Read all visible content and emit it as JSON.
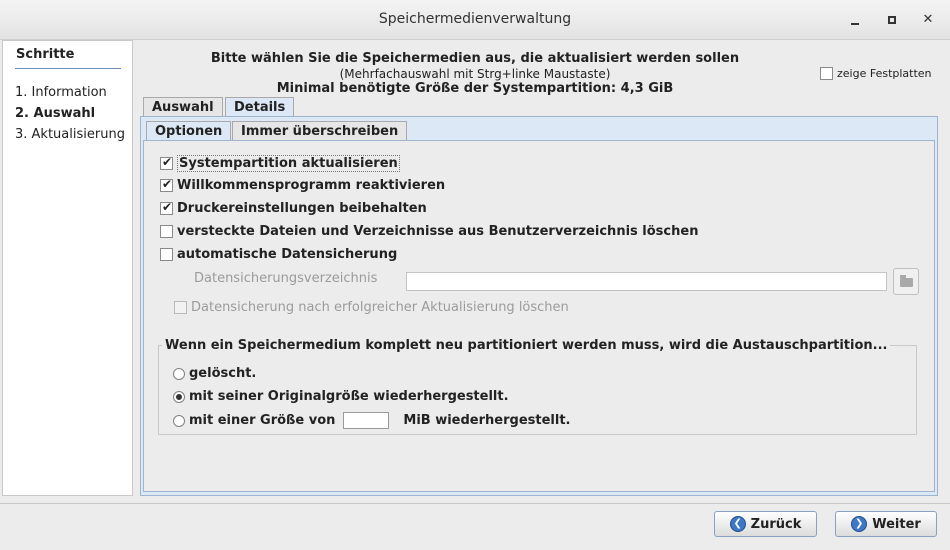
{
  "window": {
    "title": "Speichermedienverwaltung",
    "minimize_glyph": "✕",
    "maximize_glyph": "□",
    "close_glyph": "✕"
  },
  "steps": {
    "header": "Schritte",
    "items": [
      {
        "label": "1. Information",
        "active": false
      },
      {
        "label": "2. Auswahl",
        "active": true
      },
      {
        "label": "3. Aktualisierung",
        "active": false
      }
    ]
  },
  "header": {
    "line1": "Bitte wählen Sie die Speichermedien aus, die aktualisiert werden sollen",
    "line2": "(Mehrfachauswahl mit Strg+linke Maustaste)",
    "line3": "Minimal benötigte Größe der Systempartition: 4,3 GiB"
  },
  "show_disks": {
    "label": "zeige Festplatten",
    "checked": false
  },
  "tabs": [
    {
      "label": "Auswahl",
      "selected": false
    },
    {
      "label": "Details",
      "selected": true
    }
  ],
  "subtabs": [
    {
      "label": "Optionen",
      "selected": true
    },
    {
      "label": "Immer überschreiben",
      "selected": false
    }
  ],
  "options": {
    "update_system_partition": {
      "label": "Systempartition aktualisieren",
      "checked": true
    },
    "reactivate_welcome": {
      "label": "Willkommensprogramm reaktivieren",
      "checked": true
    },
    "keep_printer_settings": {
      "label": "Druckereinstellungen beibehalten",
      "checked": true
    },
    "delete_hidden_files": {
      "label": "versteckte Dateien und Verzeichnisse aus Benutzerverzeichnis löschen",
      "checked": false
    },
    "auto_backup": {
      "label": "automatische Datensicherung",
      "checked": false
    },
    "backup_dir_label": "Datensicherungsverzeichnis",
    "backup_dir_value": "",
    "delete_backup_after": {
      "label": "Datensicherung nach erfolgreicher Aktualisierung löschen",
      "checked": false
    }
  },
  "exchange_partition": {
    "legend": "Wenn ein Speichermedium komplett neu partitioniert werden muss, wird die Austauschpartition...",
    "deleted": "gelöscht.",
    "restore_original": "mit seiner Originalgröße wiederhergestellt.",
    "custom_prefix": "mit einer Größe von",
    "custom_value": "",
    "custom_suffix": "MiB wiederhergestellt.",
    "selected": "restore_original"
  },
  "buttons": {
    "back": "Zurück",
    "next": "Weiter"
  }
}
